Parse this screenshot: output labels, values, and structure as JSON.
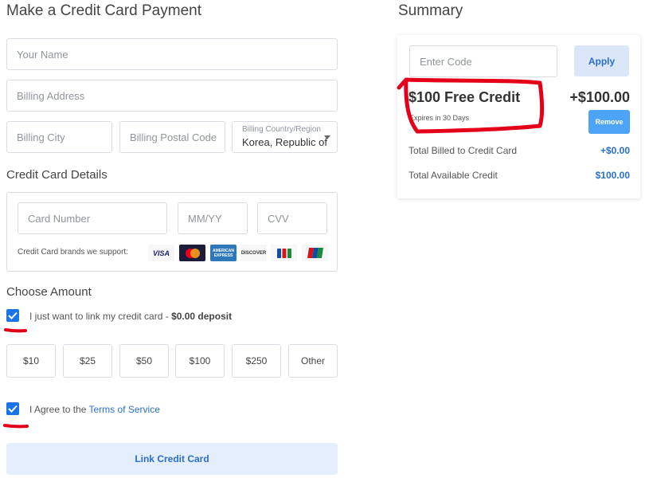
{
  "page": {
    "title": "Make a Credit Card Payment"
  },
  "billing": {
    "name_placeholder": "Your Name",
    "address_placeholder": "Billing Address",
    "city_placeholder": "Billing City",
    "postal_placeholder": "Billing Postal Code",
    "country_label": "Billing Country/Region",
    "country_value": "Korea, Republic of"
  },
  "card_details": {
    "heading": "Credit Card Details",
    "number_placeholder": "Card Number",
    "expiry_placeholder": "MM/YY",
    "cvv_placeholder": "CVV",
    "brands_text": "Credit Card brands we support:",
    "brands": [
      {
        "name": "VISA",
        "label": "VISA",
        "color": "#1a1f71"
      },
      {
        "name": "Mastercard",
        "label": "mastercard",
        "color": "#eb001b"
      },
      {
        "name": "American Express",
        "label": "AMERICAN EXPRESS",
        "color": "#2e77bb"
      },
      {
        "name": "Discover",
        "label": "DISCOVER",
        "color": "#f58220"
      },
      {
        "name": "JCB",
        "label": "JCB",
        "color": "#0b4ea2"
      },
      {
        "name": "UnionPay",
        "label": "UnionPay",
        "color": "#d7141a"
      }
    ]
  },
  "amount": {
    "heading": "Choose Amount",
    "link_only_text": "I just want to link my credit card - ",
    "link_only_bold": "$0.00 deposit",
    "link_only_checked": true,
    "options": [
      "$10",
      "$25",
      "$50",
      "$100",
      "$250",
      "Other"
    ]
  },
  "terms": {
    "prefix": "I Agree to the ",
    "link_text": "Terms of Service",
    "checked": true
  },
  "submit_label": "Link Credit Card",
  "summary": {
    "title": "Summary",
    "code_placeholder": "Enter Code",
    "apply_label": "Apply",
    "credit_title": "$100 Free Credit",
    "credit_amount": "+$100.00",
    "credit_expiry": "Expires in 30 Days",
    "remove_label": "Remove",
    "billed_label": "Total Billed to Credit Card",
    "billed_value": "+$0.00",
    "available_label": "Total Available Credit",
    "available_value": "$100.00"
  },
  "colors": {
    "accent": "#1a73e8",
    "link_blue": "#2a6fc9",
    "annotation_red": "#e5001a"
  }
}
